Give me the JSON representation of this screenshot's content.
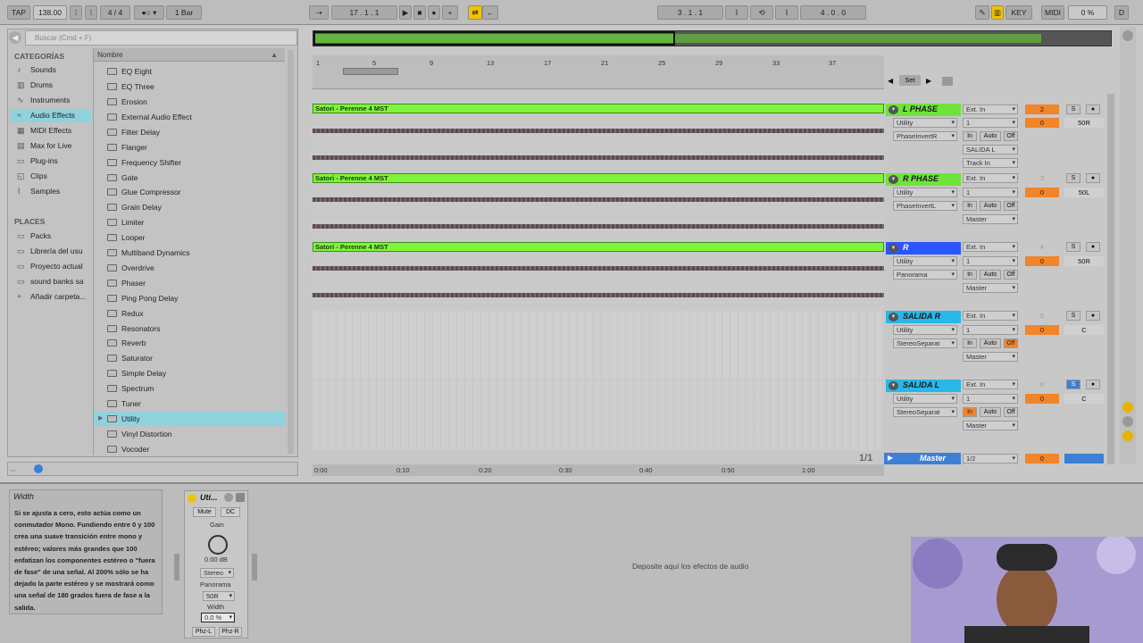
{
  "transport": {
    "tap": "TAP",
    "tempo": "138.00",
    "time_sig": "4 / 4",
    "quantize": "1 Bar",
    "position": "17 .   1 .   1",
    "loop_start": "3 .   1 .   1",
    "loop_length": "4 .   0 .   0",
    "key": "KEY",
    "midi": "MIDI",
    "cpu": "0 %",
    "d": "D"
  },
  "browser": {
    "search_placeholder": "Buscar (Cmd + F)",
    "categories_title": "CATEGORÍAS",
    "categories": [
      "Sounds",
      "Drums",
      "Instruments",
      "Audio Effects",
      "MIDI Effects",
      "Max for Live",
      "Plug-ins",
      "Clips",
      "Samples"
    ],
    "places_title": "PLACES",
    "places": [
      "Packs",
      "Librería del usu",
      "Proyecto actual",
      "sound banks sa",
      "Añadir carpeta..."
    ],
    "list_header": "Nombre",
    "items": [
      "EQ Eight",
      "EQ Three",
      "Erosion",
      "External Audio Effect",
      "Filter Delay",
      "Flanger",
      "Frequency Shifter",
      "Gate",
      "Glue Compressor",
      "Grain Delay",
      "Limiter",
      "Looper",
      "Multiband Dynamics",
      "Overdrive",
      "Phaser",
      "Ping Pong Delay",
      "Redux",
      "Resonators",
      "Reverb",
      "Saturator",
      "Simple Delay",
      "Spectrum",
      "Tuner",
      "Utility",
      "Vinyl Distortion",
      "Vocoder"
    ]
  },
  "ruler": {
    "marks": [
      "1",
      "5",
      "9",
      "13",
      "17",
      "21",
      "25",
      "29",
      "33",
      "37"
    ],
    "set": "Set"
  },
  "tracks": [
    {
      "name": "L PHASE",
      "clip": "Satori - Perenne 4 MST",
      "dev1": "Utility",
      "dev2": "PhaseInvertR",
      "in": "Ext. In",
      "ch": "1",
      "route": "SALIDA L",
      "track_in": "Track In",
      "num": "2",
      "vol": "0",
      "pan": "50R",
      "monitor": [
        "In",
        "Auto",
        "Off"
      ]
    },
    {
      "name": "R PHASE",
      "clip": "Satori - Perenne 4 MST",
      "dev1": "Utility",
      "dev2": "PhaseInvertL",
      "in": "Ext. In",
      "ch": "1",
      "route": "Master",
      "num": "3",
      "vol": "0",
      "pan": "50L",
      "monitor": [
        "In",
        "Auto",
        "Off"
      ]
    },
    {
      "name": "R",
      "clip": "Satori - Perenne 4 MST",
      "dev1": "Utility",
      "dev2": "Panorama",
      "in": "Ext. In",
      "ch": "1",
      "route": "Master",
      "num": "4",
      "vol": "0",
      "pan": "50R",
      "monitor": [
        "In",
        "Auto",
        "Off"
      ]
    },
    {
      "name": "SALIDA R",
      "dev1": "Utility",
      "dev2": "StereoSeparat",
      "in": "Ext. In",
      "ch": "1",
      "route": "Master",
      "num": "5",
      "vol": "0",
      "pan": "C",
      "monitor": [
        "In",
        "Auto",
        "Off"
      ]
    },
    {
      "name": "SALIDA L",
      "dev1": "Utility",
      "dev2": "StereoSeparat",
      "in": "Ext. In",
      "ch": "1",
      "route": "Master",
      "num": "6",
      "vol": "0",
      "pan": "C",
      "monitor": [
        "In",
        "Auto",
        "Off"
      ]
    }
  ],
  "master": {
    "name": "Master",
    "ratio": "1/2",
    "vol": "0",
    "page": "1/1"
  },
  "timebar": [
    "0:00",
    "0:10",
    "0:20",
    "0:30",
    "0:40",
    "0:50",
    "1:00"
  ],
  "info": {
    "title": "Width",
    "text": "Si se ajusta a cero, esto actúa como un conmutador Mono. Fundiendo entre 0 y 100 crea una suave transición entre mono y estéreo; valores más grandes que 100 enfatizan los componentes estéreo o \"fuera de fase\" de una señal. Al 200% sólo se ha dejado la parte estéreo y se mostrará como una señal de 180 grados fuera de fase a la salida."
  },
  "device": {
    "title": "Uti...",
    "mute": "Mute",
    "dc": "DC",
    "gain_label": "Gain",
    "gain_value": "0.00 dB",
    "mode": "Stereo",
    "panorama_label": "Panorama",
    "panorama_value": "50R",
    "width_label": "Width",
    "width_value": "0.0 %",
    "phz_l": "Phz-L",
    "phz_r": "Phz-R"
  },
  "dropzone": "Deposite aquí los efectos de audio",
  "colors": {
    "clip_green": "#7ef53b",
    "track_green": "#6fe33a",
    "selection_blue": "#8fd2dd",
    "blue_track": "#2a55ff",
    "accent_orange": "#f2842a"
  }
}
